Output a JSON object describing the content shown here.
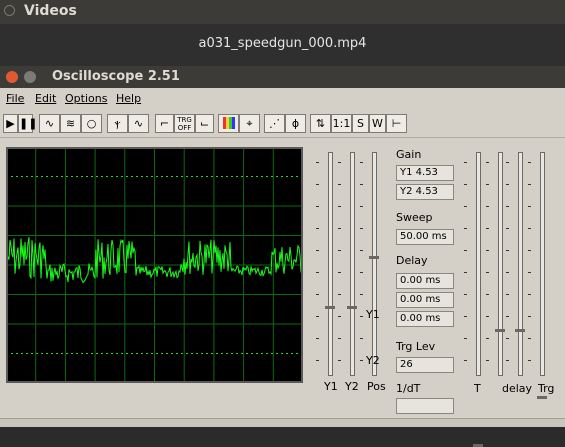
{
  "top": {
    "title": "Videos"
  },
  "video": {
    "filename": "a031_speedgun_000.mp4"
  },
  "window": {
    "title": "Oscilloscope 2.51"
  },
  "menu": {
    "items": [
      "File",
      "Edit",
      "Options",
      "Help"
    ]
  },
  "toolbar": {
    "buttons": [
      {
        "name": "play-icon",
        "label": "▶"
      },
      {
        "name": "pause-icon",
        "label": "❚❚"
      },
      {
        "name": "wave-mode-icon",
        "label": "∿"
      },
      {
        "name": "noise-wave-icon",
        "label": "≋"
      },
      {
        "name": "lissajous-icon",
        "label": "○"
      },
      {
        "name": "pulse-train-icon",
        "label": "ⲯ"
      },
      {
        "name": "sine-icon",
        "label": "∿"
      },
      {
        "name": "trigger-rise-icon",
        "label": "⌐"
      },
      {
        "name": "trigger-off-icon",
        "label": "TRG\nOFF"
      },
      {
        "name": "trigger-fall-icon",
        "label": "⌙"
      },
      {
        "name": "color-bars-icon",
        "label": "▮"
      },
      {
        "name": "marker-icon",
        "label": "⌖"
      },
      {
        "name": "graph-icon",
        "label": "⋰"
      },
      {
        "name": "phase-icon",
        "label": "ϕ"
      },
      {
        "name": "scale-arrows-icon",
        "label": "⇅"
      },
      {
        "name": "one-to-one-button",
        "label": "1:1"
      },
      {
        "name": "s-button",
        "label": "S"
      },
      {
        "name": "w-button",
        "label": "W"
      },
      {
        "name": "split-icon",
        "label": "⊢"
      }
    ]
  },
  "panel": {
    "gain_label": "Gain",
    "y1_gain": "Y1  4.53",
    "y2_gain": "Y2  4.53",
    "sweep_label": "Sweep",
    "sweep_value": "50.00 ms",
    "delay_label": "Delay",
    "delays": [
      "0.00 ms",
      "0.00 ms",
      "0.00 ms"
    ],
    "trg_label": "Trg Lev",
    "trg_value": "26",
    "dt_label": "1/dT",
    "dt_value": ""
  },
  "sliders": {
    "y1_label": "Y1",
    "y2_label": "Y2",
    "pos_label": "Pos",
    "side_y1": "Y1",
    "side_y2": "Y2",
    "t_label": "T",
    "delay_label": "delay",
    "trg_label": "Trg"
  }
}
